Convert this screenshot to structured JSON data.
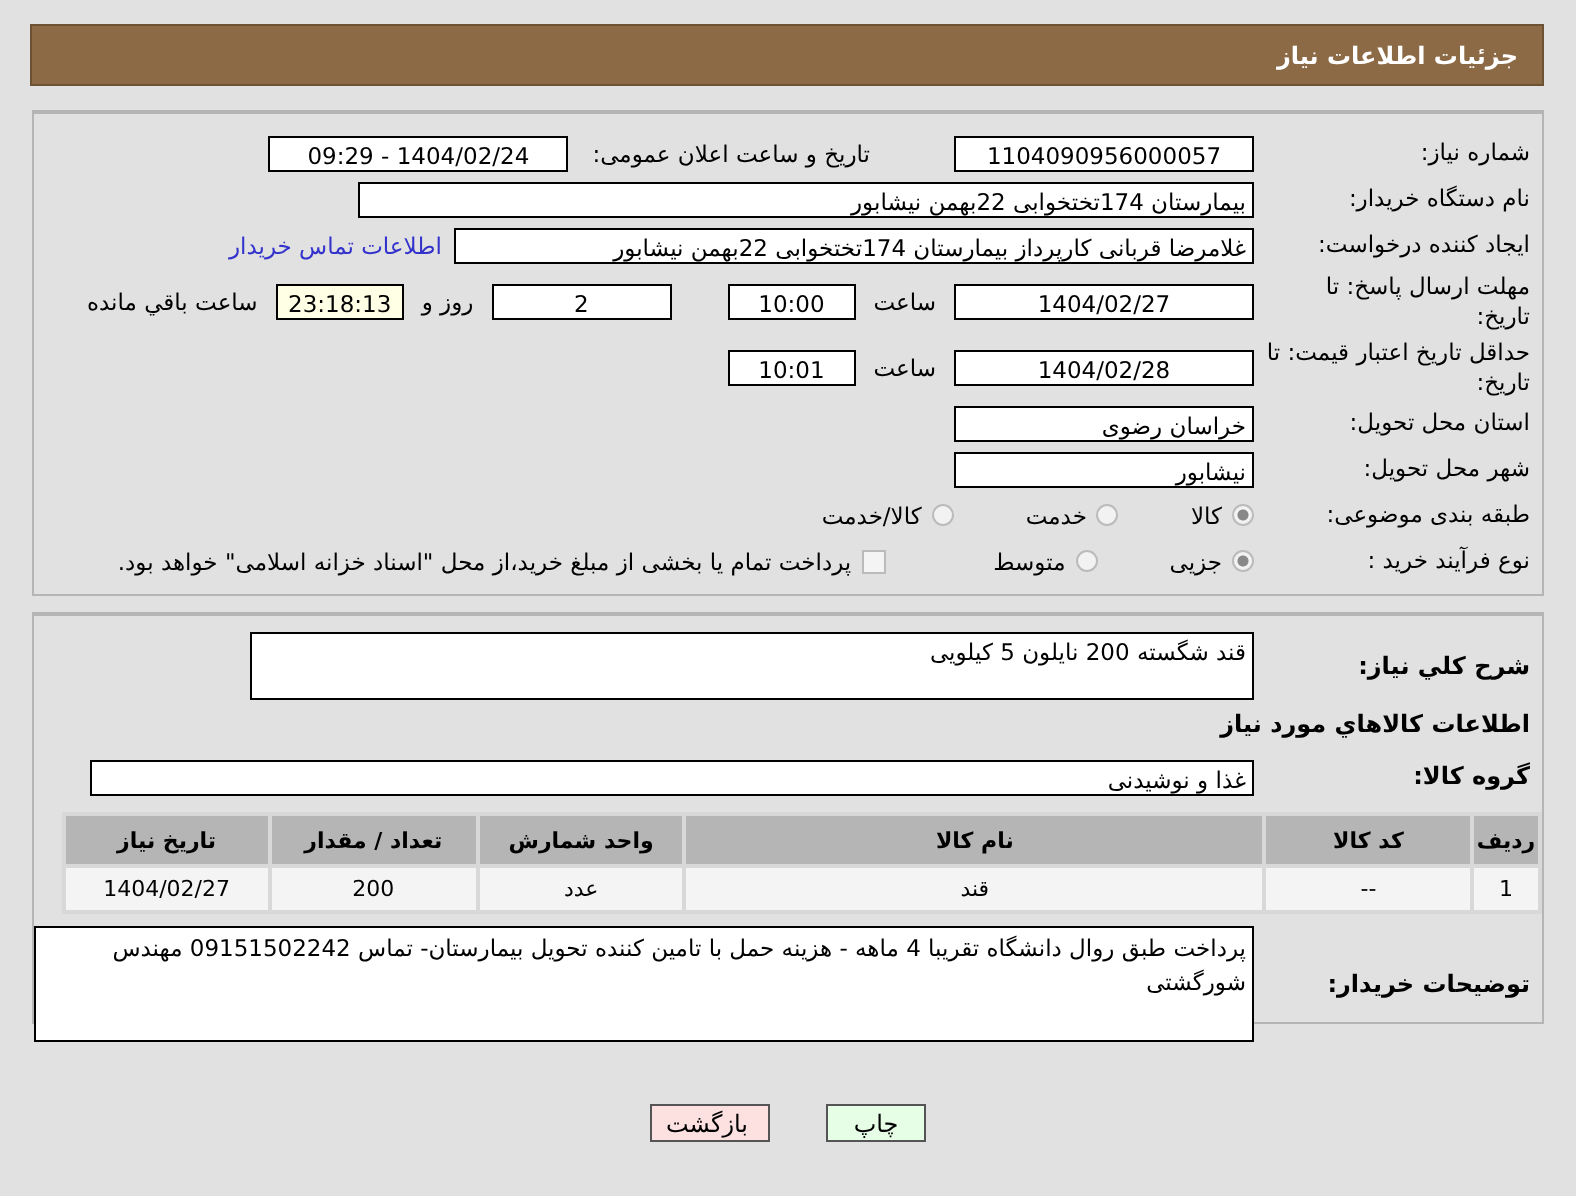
{
  "header": {
    "title": "جزئیات اطلاعات نیاز"
  },
  "form": {
    "need_number": {
      "label": "شماره نیاز:",
      "value": "1104090956000057"
    },
    "announce": {
      "label": "تاریخ و ساعت اعلان عمومی:",
      "value": "1404/02/24 - 09:29"
    },
    "buyer": {
      "label": "نام دستگاه خریدار:",
      "value": "بیمارستان 174تختخوابی 22بهمن نیشابور"
    },
    "creator": {
      "label": "ایجاد کننده درخواست:",
      "value": "غلامرضا قربانی کارپرداز بیمارستان 174تختخوابی 22بهمن نیشابور",
      "link": "اطلاعات تماس خریدار"
    },
    "deadline": {
      "label": "مهلت ارسال پاسخ: تا تاریخ:",
      "date": "1404/02/27",
      "time_label": "ساعت",
      "time": "10:00",
      "days": "2",
      "days_label": "روز و",
      "remaining": "23:18:13",
      "remaining_label": "ساعت باقي مانده"
    },
    "validity": {
      "label": "حداقل تاریخ اعتبار قیمت: تا تاریخ:",
      "date": "1404/02/28",
      "time_label": "ساعت",
      "time": "10:01"
    },
    "province": {
      "label": "استان محل تحویل:",
      "value": "خراسان رضوی"
    },
    "city": {
      "label": "شهر محل تحویل:",
      "value": "نیشابور"
    },
    "category": {
      "label": "طبقه بندی موضوعی:",
      "options": [
        {
          "label": "کالا",
          "selected": true
        },
        {
          "label": "خدمت",
          "selected": false
        },
        {
          "label": "کالا/خدمت",
          "selected": false
        }
      ]
    },
    "process": {
      "label": "نوع فرآیند خرید :",
      "options": [
        {
          "label": "جزیی",
          "selected": true
        },
        {
          "label": "متوسط",
          "selected": false
        }
      ],
      "treasury": {
        "label": "پرداخت تمام یا بخشی از مبلغ خرید،از محل \"اسناد خزانه اسلامی\" خواهد بود.",
        "checked": false
      }
    }
  },
  "details": {
    "description": {
      "label": "شرح کلي نیاز:",
      "value": "قند شگسته 200 نایلون 5 کیلویی"
    },
    "goods_heading": "اطلاعات کالاهاي مورد نیاز",
    "group": {
      "label": "گروه کالا:",
      "value": "غذا و نوشیدنی"
    },
    "table": {
      "columns": [
        "ردیف",
        "کد کالا",
        "نام کالا",
        "واحد شمارش",
        "تعداد / مقدار",
        "تاریخ نیاز"
      ],
      "rows": [
        [
          "1",
          "--",
          "قند",
          "عدد",
          "200",
          "1404/02/27"
        ]
      ]
    },
    "notes": {
      "label": "توضیحات خریدار:",
      "value": "پرداخت طبق روال دانشگاه تقریبا 4 ماهه - هزینه  حمل با تامین کننده تحویل بیمارستان- تماس 09151502242 مهندس شورگشتی"
    }
  },
  "buttons": [
    {
      "label": "چاپ",
      "kind": "print"
    },
    {
      "label": "بازگشت",
      "kind": "back"
    }
  ]
}
